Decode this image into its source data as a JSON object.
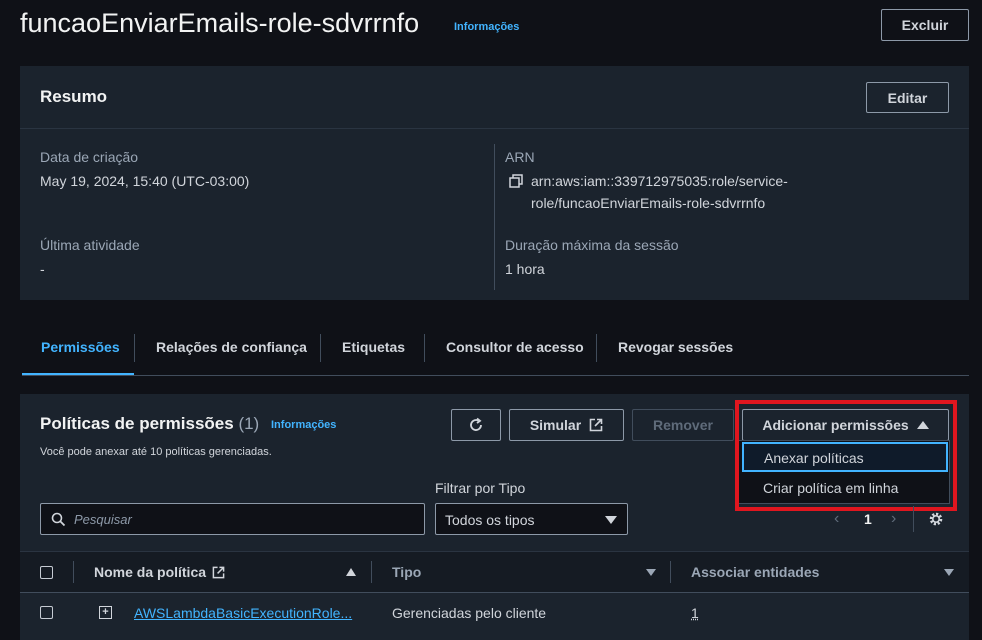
{
  "header": {
    "title": "funcaoEnviarEmails-role-sdvrrnfo",
    "info_link": "Informações",
    "delete_button": "Excluir"
  },
  "summary": {
    "title": "Resumo",
    "edit_button": "Editar",
    "creation_label": "Data de criação",
    "creation_value": "May 19, 2024, 15:40 (UTC-03:00)",
    "arn_label": "ARN",
    "arn_line1": "arn:aws:iam::339712975035:role/service-",
    "arn_line2": "role/funcaoEnviarEmails-role-sdvrrnfo",
    "last_activity_label": "Última atividade",
    "last_activity_value": "-",
    "max_session_label": "Duração máxima da sessão",
    "max_session_value": "1 hora"
  },
  "tabs": [
    {
      "label": "Permissões",
      "active": true
    },
    {
      "label": "Relações de confiança"
    },
    {
      "label": "Etiquetas"
    },
    {
      "label": "Consultor de acesso"
    },
    {
      "label": "Revogar sessões"
    }
  ],
  "policies": {
    "title": "Políticas de permissões",
    "count": "(1)",
    "info_link": "Informações",
    "description": "Você pode anexar até 10 políticas gerenciadas.",
    "simulate_button": "Simular",
    "remove_button": "Remover",
    "add_button": "Adicionar permissões",
    "menu": [
      "Anexar políticas",
      "Criar política em linha"
    ],
    "filter_label": "Filtrar por Tipo",
    "search_placeholder": "Pesquisar",
    "filter_value": "Todos os tipos",
    "page_number": "1",
    "columns": [
      "Nome da política",
      "Tipo",
      "Associar entidades"
    ],
    "rows": [
      {
        "name": "AWSLambdaBasicExecutionRole...",
        "type": "Gerenciadas pelo cliente",
        "entities": "1"
      }
    ]
  },
  "colors": {
    "background": "#0f1117",
    "panel": "#1b232d",
    "link": "#42b4ff",
    "highlight": "#e0161f"
  }
}
